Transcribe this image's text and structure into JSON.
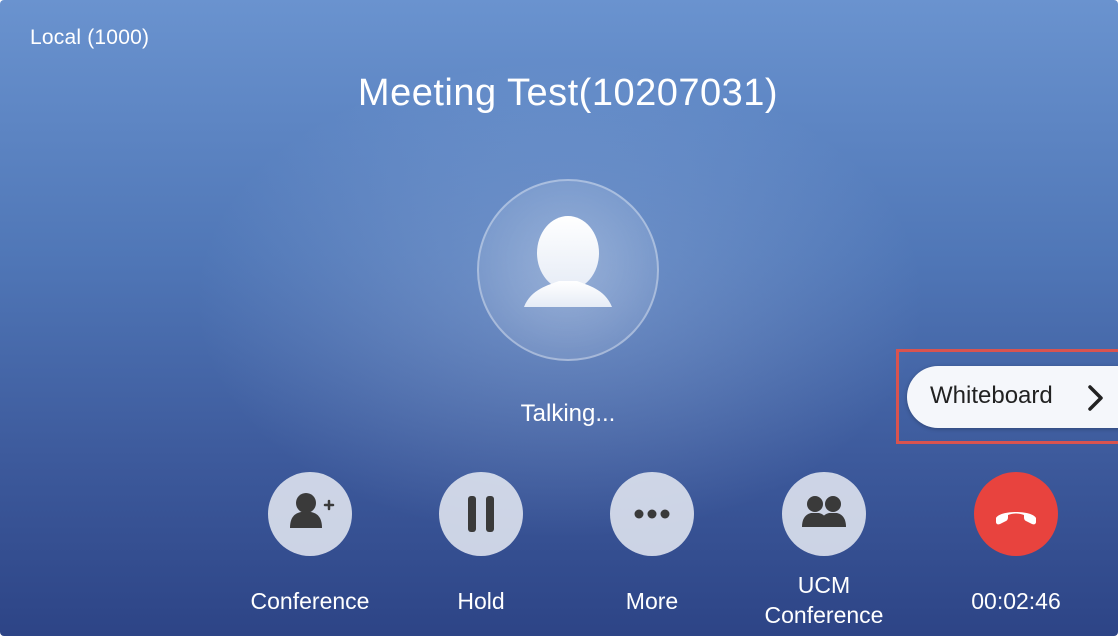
{
  "header": {
    "local_label": "Local (1000)",
    "meeting_title": "Meeting Test(10207031)"
  },
  "call": {
    "status": "Talking...",
    "duration": "00:02:46"
  },
  "side_panel": {
    "whiteboard_label": "Whiteboard",
    "highlight_color": "#d9534f"
  },
  "actions": [
    {
      "label": "Conference",
      "icon": "add-person-icon"
    },
    {
      "label": "Hold",
      "icon": "pause-icon"
    },
    {
      "label": "More",
      "icon": "more-dots-icon"
    },
    {
      "label_line1": "UCM",
      "label_line2": "Conference",
      "icon": "group-icon"
    },
    {
      "icon": "hang-up-icon",
      "color": "#e8433e"
    }
  ]
}
